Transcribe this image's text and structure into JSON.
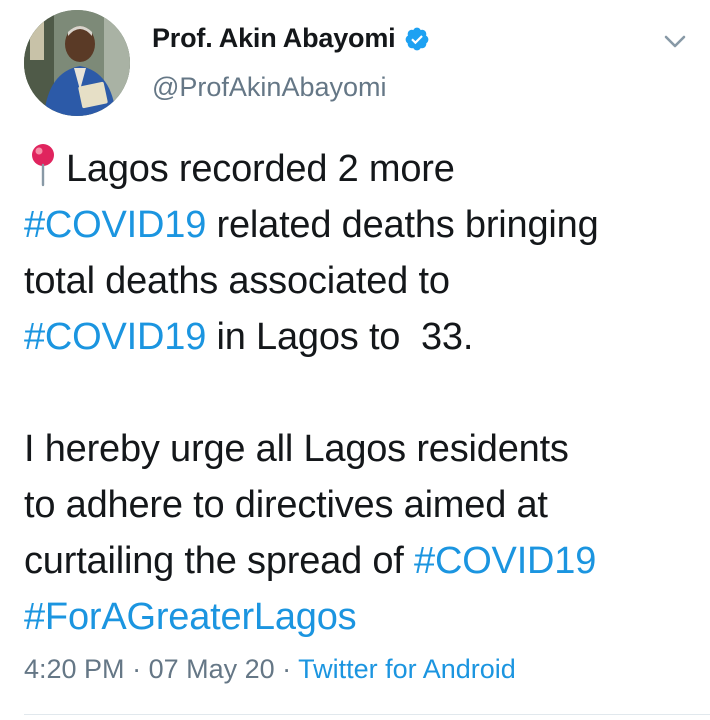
{
  "author": {
    "display_name": "Prof. Akin Abayomi",
    "handle": "@ProfAkinAbayomi",
    "verified": true
  },
  "icons": {
    "avatar": "profile-photo",
    "verified": "verified-badge-icon",
    "menu": "chevron-down-icon",
    "pin": "round-pushpin-icon"
  },
  "tweet": {
    "lines": [
      [
        {
          "t": "Lagos recorded 2 more",
          "tag": false
        }
      ],
      [
        {
          "t": "#COVID19",
          "tag": true
        },
        {
          "t": " related deaths bringing",
          "tag": false
        }
      ],
      [
        {
          "t": "total deaths associated to",
          "tag": false
        }
      ],
      [
        {
          "t": "#COVID19",
          "tag": true
        },
        {
          "t": " in Lagos to  33.",
          "tag": false
        }
      ],
      null,
      [
        {
          "t": "I hereby urge all Lagos residents",
          "tag": false
        }
      ],
      [
        {
          "t": "to adhere to directives aimed at",
          "tag": false
        }
      ],
      [
        {
          "t": "curtailing the spread of ",
          "tag": false
        },
        {
          "t": "#COVID19",
          "tag": true
        }
      ],
      [
        {
          "t": "#ForAGreaterLagos",
          "tag": true
        }
      ]
    ]
  },
  "meta": {
    "time": "4:20 PM",
    "separator": " · ",
    "date": "07 May 20",
    "source": "Twitter for Android"
  },
  "colors": {
    "link": "#1b95e0",
    "secondary_text": "#657786",
    "primary_text": "#14171a",
    "verified": "#1da1f2",
    "divider": "#e1e8ed"
  }
}
